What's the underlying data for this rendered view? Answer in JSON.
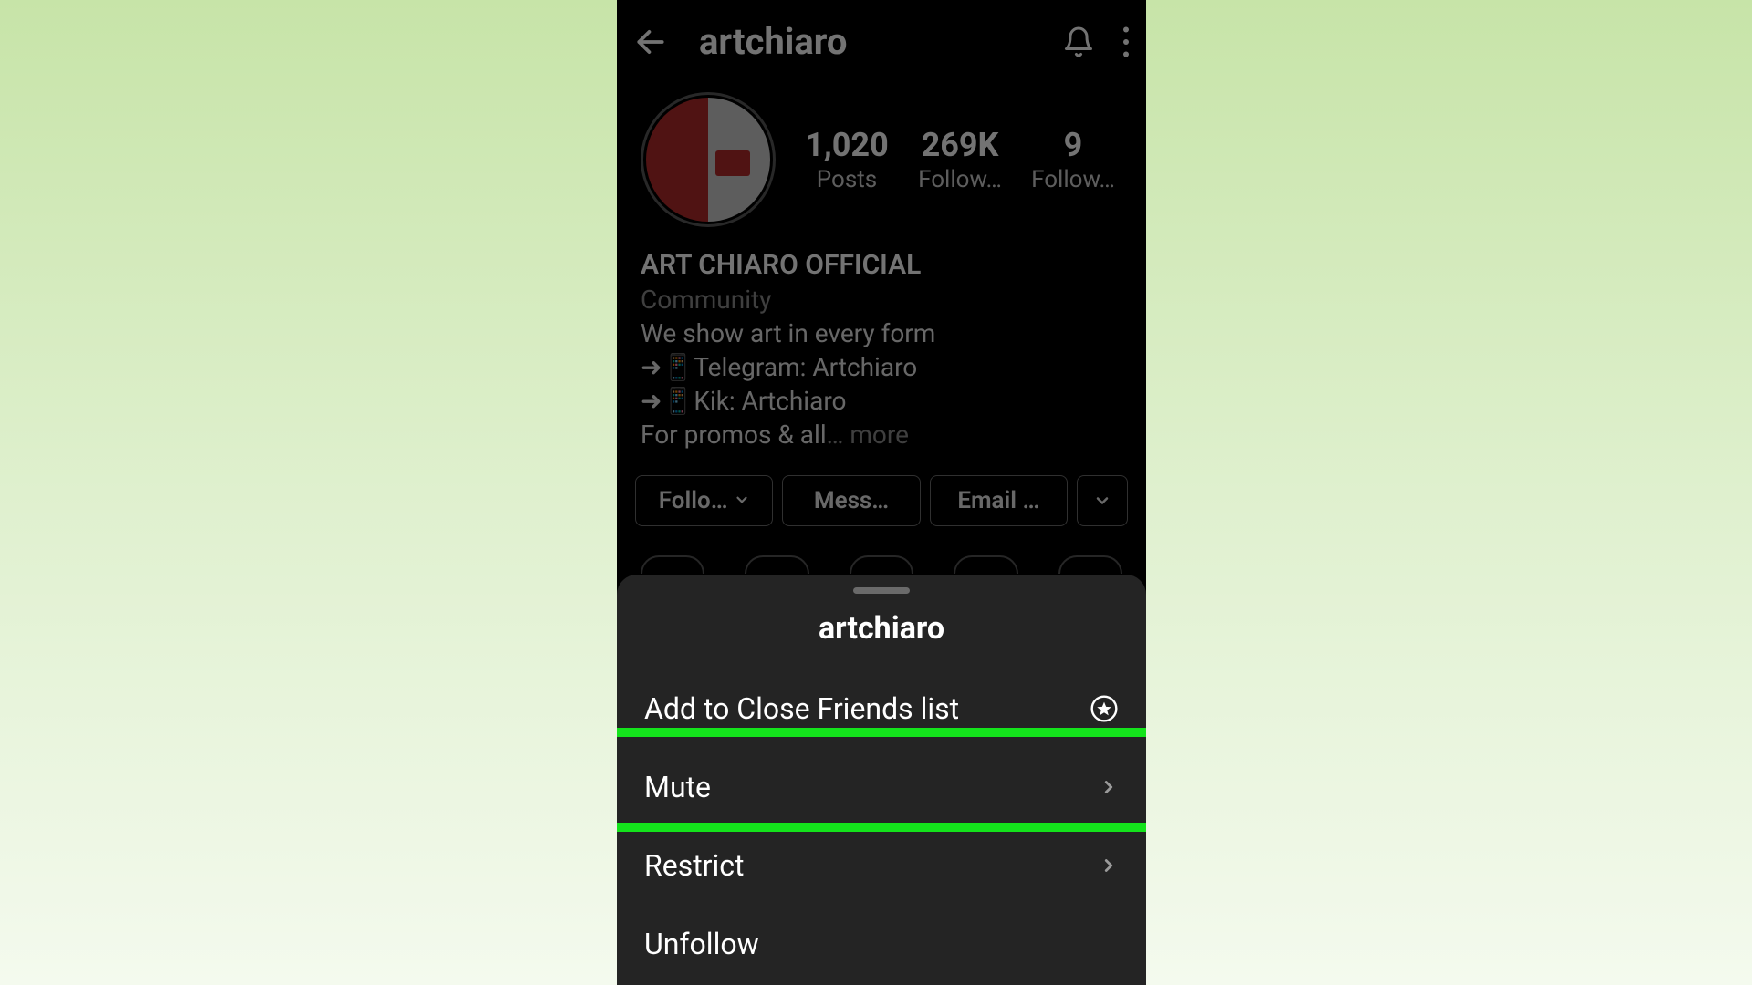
{
  "header": {
    "username": "artchiaro"
  },
  "stats": {
    "posts_value": "1,020",
    "posts_label": "Posts",
    "followers_value": "269K",
    "followers_label": "Follow…",
    "following_value": "9",
    "following_label": "Follow…"
  },
  "bio": {
    "display_name": "ART CHIARO OFFICIAL",
    "category": "Community",
    "line1": "We show art in every form",
    "line2": "➜📱Telegram: Artchiaro",
    "line3": "➜📱Kik: Artchiaro",
    "line4_prefix": "For promos & all",
    "line4_ellipsis": "… ",
    "more": "more"
  },
  "actions": {
    "following": "Follo…",
    "message": "Mess…",
    "email": "Email …"
  },
  "sheet": {
    "title": "artchiaro",
    "items": {
      "close_friends": "Add to Close Friends list",
      "mute": "Mute",
      "restrict": "Restrict",
      "unfollow": "Unfollow"
    }
  }
}
